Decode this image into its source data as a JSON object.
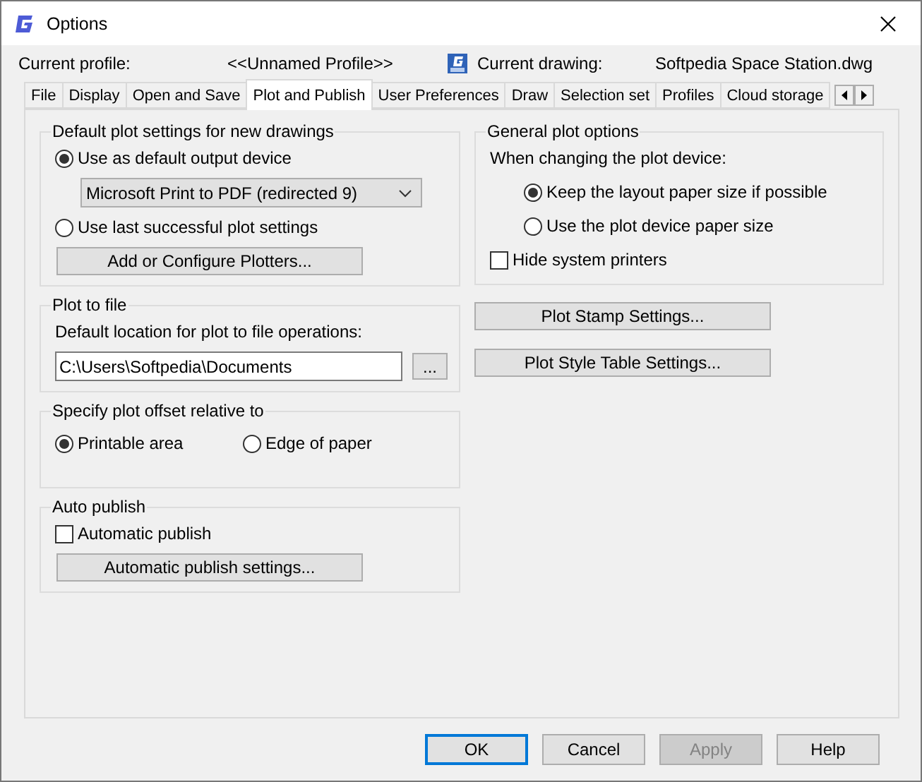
{
  "window": {
    "title": "Options"
  },
  "header": {
    "profile_label": "Current profile:",
    "profile_value": "<<Unnamed Profile>>",
    "drawing_label": "Current drawing:",
    "drawing_value": "Softpedia Space Station.dwg"
  },
  "tabs": [
    {
      "label": "File",
      "selected": false
    },
    {
      "label": "Display",
      "selected": false
    },
    {
      "label": "Open and Save",
      "selected": false
    },
    {
      "label": "Plot and Publish",
      "selected": true
    },
    {
      "label": "User Preferences",
      "selected": false
    },
    {
      "label": "Draw",
      "selected": false
    },
    {
      "label": "Selection set",
      "selected": false
    },
    {
      "label": "Profiles",
      "selected": false
    },
    {
      "label": "Cloud storage",
      "selected": false
    }
  ],
  "left_groups": [
    {
      "title": "Default plot settings for new drawings",
      "items": [
        {
          "kind": "radio",
          "label": "Use as default output device",
          "selected": true
        },
        {
          "kind": "select",
          "value": "Microsoft Print to PDF (redirected 9)"
        },
        {
          "kind": "radio",
          "label": "Use last successful plot settings",
          "selected": false
        },
        {
          "kind": "button",
          "label": "Add or Configure Plotters..."
        }
      ]
    },
    {
      "title": "Plot to file",
      "items": [
        {
          "kind": "text",
          "label": "Default location for plot to file operations:"
        },
        {
          "kind": "path",
          "value": "C:\\Users\\Softpedia\\Documents",
          "browse": "..."
        }
      ]
    },
    {
      "title": "Specify plot offset relative to",
      "items": [
        {
          "kind": "radio_row",
          "options": [
            {
              "label": "Printable area",
              "selected": true
            },
            {
              "label": "Edge of paper",
              "selected": false
            }
          ]
        }
      ]
    },
    {
      "title": "Auto publish",
      "items": [
        {
          "kind": "checkbox",
          "label": "Automatic publish",
          "checked": false
        },
        {
          "kind": "button",
          "label": "Automatic publish settings..."
        }
      ]
    }
  ],
  "right_groups": [
    {
      "title": "General plot options",
      "items": [
        {
          "kind": "text",
          "label": "When changing the plot device:"
        },
        {
          "kind": "radio",
          "label": "Keep the layout paper size if possible",
          "selected": true,
          "indented": true
        },
        {
          "kind": "radio",
          "label": "Use the plot device paper size",
          "selected": false,
          "indented": true
        },
        {
          "kind": "checkbox",
          "label": "Hide system printers",
          "checked": false
        }
      ]
    }
  ],
  "right_buttons": [
    "Plot Stamp Settings...",
    "Plot Style Table Settings..."
  ],
  "footer_buttons": [
    {
      "label": "OK",
      "default": true,
      "disabled": false
    },
    {
      "label": "Cancel",
      "default": false,
      "disabled": false
    },
    {
      "label": "Apply",
      "default": false,
      "disabled": true
    },
    {
      "label": "Help",
      "default": false,
      "disabled": false
    }
  ]
}
